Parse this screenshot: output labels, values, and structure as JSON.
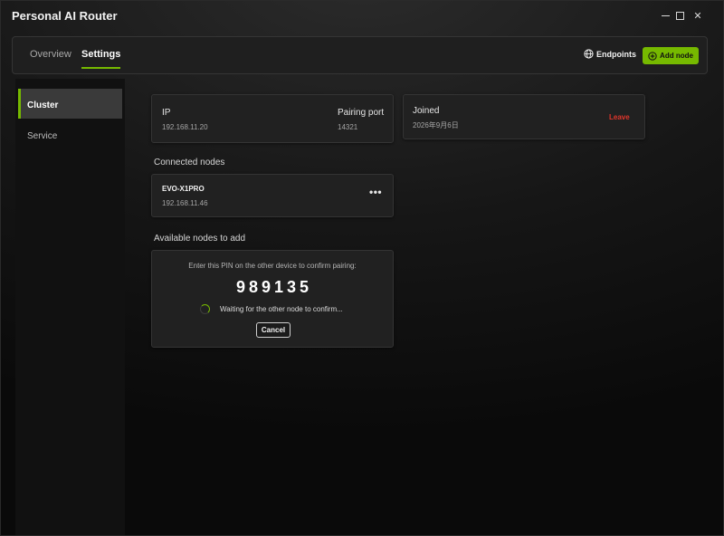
{
  "app": {
    "title": "Personal AI Router"
  },
  "window_controls": {
    "minimize_icon": "minimize-icon",
    "maximize_icon": "maximize-icon",
    "close_glyph": "✕"
  },
  "nav": {
    "tabs": [
      {
        "label": "Overview"
      },
      {
        "label": "Settings",
        "active": true
      }
    ],
    "endpoints_label": "Endpoints",
    "add_node_label": "Add node",
    "accent": "#76b900"
  },
  "sidebar": {
    "items": [
      {
        "label": "Cluster",
        "active": true
      },
      {
        "label": "Service"
      }
    ]
  },
  "cluster": {
    "ip_label": "IP",
    "ip_value": "192.168.11.20",
    "pairing_port_label": "Pairing port",
    "pairing_port_value": "14321",
    "joined_label": "Joined",
    "joined_date": "2026年9月6日",
    "leave_label": "Leave",
    "leave_color": "#e0352b"
  },
  "connected": {
    "title": "Connected nodes",
    "nodes": [
      {
        "name": "EVO-X1PRO",
        "ip": "192.168.11.46",
        "menu": "•••"
      }
    ]
  },
  "available": {
    "title": "Available nodes to add",
    "pin_instruction": "Enter this PIN on the other device to confirm pairing:",
    "pin": "989135",
    "waiting_text": "Waiting for the other node to confirm...",
    "cancel_label": "Cancel"
  }
}
